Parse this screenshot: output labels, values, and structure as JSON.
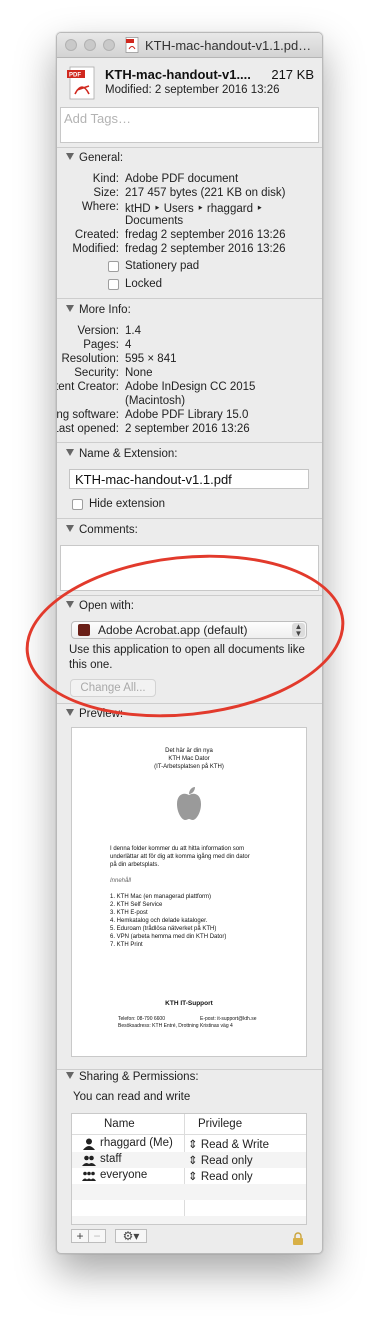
{
  "window": {
    "title": "KTH-mac-handout-v1.1.pd…"
  },
  "header": {
    "file_name": "KTH-mac-handout-v1....",
    "file_size": "217 KB",
    "modified": "Modified: 2 september 2016 13:26",
    "tags_placeholder": "Add Tags…"
  },
  "general": {
    "heading": "General:",
    "rows": [
      {
        "label": "Kind:",
        "value": "Adobe PDF document"
      },
      {
        "label": "Size:",
        "value": "217 457 bytes (221 KB on disk)"
      },
      {
        "label": "Where:",
        "value": "ktHD ‣ Users ‣ rhaggard ‣"
      },
      {
        "label": "",
        "value": "Documents"
      },
      {
        "label": "Created:",
        "value": "fredag 2 september 2016 13:26"
      },
      {
        "label": "Modified:",
        "value": "fredag 2 september 2016 13:26"
      }
    ],
    "stationery_label": "Stationery pad",
    "locked_label": "Locked"
  },
  "more_info": {
    "heading": "More Info:",
    "rows": [
      {
        "label": "Version:",
        "value": "1.4"
      },
      {
        "label": "Pages:",
        "value": "4"
      },
      {
        "label": "Resolution:",
        "value": "595 × 841"
      },
      {
        "label": "Security:",
        "value": "None"
      },
      {
        "label": "Content Creator:",
        "value": "Adobe InDesign CC 2015"
      },
      {
        "label": "",
        "value": "(Macintosh)"
      },
      {
        "label": "Encoding software:",
        "value": "Adobe PDF Library 15.0"
      },
      {
        "label": "Last opened:",
        "value": "2 september 2016 13:26"
      }
    ]
  },
  "name_extension": {
    "heading": "Name & Extension:",
    "file_name": "KTH-mac-handout-v1.1.pdf",
    "hide_extension_label": "Hide extension"
  },
  "comments": {
    "heading": "Comments:"
  },
  "open_with": {
    "heading": "Open with:",
    "selected_app": "Adobe Acrobat.app (default)",
    "description": "Use this application to open all documents like this one.",
    "change_all_label": "Change All..."
  },
  "preview": {
    "heading": "Preview:",
    "doc_title_1": "Det här är din nya",
    "doc_title_2": "KTH Mac Dator",
    "doc_title_3": "(IT-Arbetsplatsen på KTH)",
    "intro_1": "I denna folder kommer du att hitta information som",
    "intro_2": "underlättar att för dig att komma igång med din dator",
    "intro_3": "på din arbetsplats.",
    "contents_label": "Innehåll",
    "items": [
      "1. KTH Mac (en managerad plattform)",
      "2. KTH Self Service",
      "3. KTH E-post",
      "4. Hemkatalog och delade kataloger.",
      "5. Eduroam (trådlösa nätverket på KTH)",
      "6. VPN (arbeta hemma med din KTH Dator)",
      "7. KTH Print"
    ],
    "footer_title": "KTH IT-Support",
    "phone": "Telefon: 08-790 6600",
    "email": "E-post: it-support@kth.se",
    "address": "Besöksadress: KTH Entré, Drottning Kristinas väg 4"
  },
  "sharing": {
    "heading": "Sharing & Permissions:",
    "subtitle": "You can read and write",
    "col_name": "Name",
    "col_privilege": "Privilege",
    "rows": [
      {
        "name": "rhaggard (Me)",
        "privilege": "Read & Write",
        "icon": "user-icon"
      },
      {
        "name": "staff",
        "privilege": "Read only",
        "icon": "group-icon"
      },
      {
        "name": "everyone",
        "privilege": "Read only",
        "icon": "everyone-icon"
      }
    ],
    "add_label": "+",
    "remove_label": "−",
    "gear_label": "⚙▾"
  },
  "colors": {
    "annotation": "#e23a2c",
    "pdf_red": "#d0281e"
  }
}
